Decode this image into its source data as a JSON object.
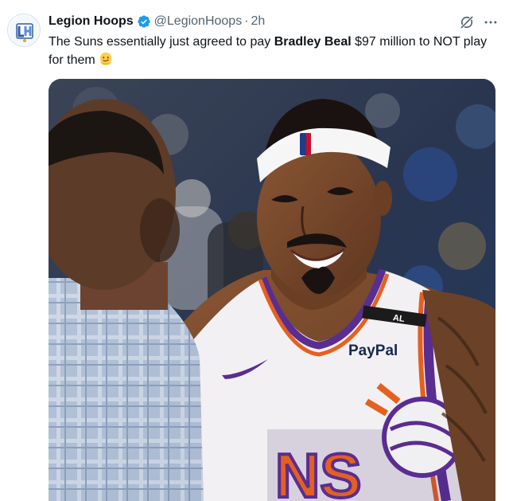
{
  "tweet": {
    "author_name": "Legion Hoops",
    "author_handle": "@LegionHoops",
    "separator": "·",
    "timestamp": "2h",
    "text_before": "The Suns essentially just agreed to pay ",
    "text_bold": "Bradley Beal",
    "text_after": " $97 million to NOT play for them",
    "emoji": "melting-face-emoji",
    "verified_color": "#1d9bf0"
  },
  "media": {
    "type": "photo",
    "jersey_sponsor": "PayPal",
    "jersey_patch": "AL",
    "jersey_text": "NS"
  },
  "icons": {
    "grok": "grok-icon",
    "more": "more-icon",
    "verified": "verified-badge-icon"
  }
}
